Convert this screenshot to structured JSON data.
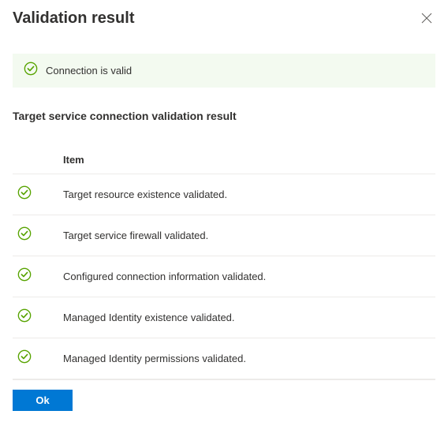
{
  "header": {
    "title": "Validation result"
  },
  "banner": {
    "message": "Connection is valid"
  },
  "section": {
    "subtitle": "Target service connection validation result"
  },
  "table": {
    "column_header": "Item",
    "rows": [
      {
        "text": "Target resource existence validated."
      },
      {
        "text": "Target service firewall validated."
      },
      {
        "text": "Configured connection information validated."
      },
      {
        "text": "Managed Identity existence validated."
      },
      {
        "text": "Managed Identity permissions validated."
      }
    ]
  },
  "footer": {
    "ok_label": "Ok"
  }
}
